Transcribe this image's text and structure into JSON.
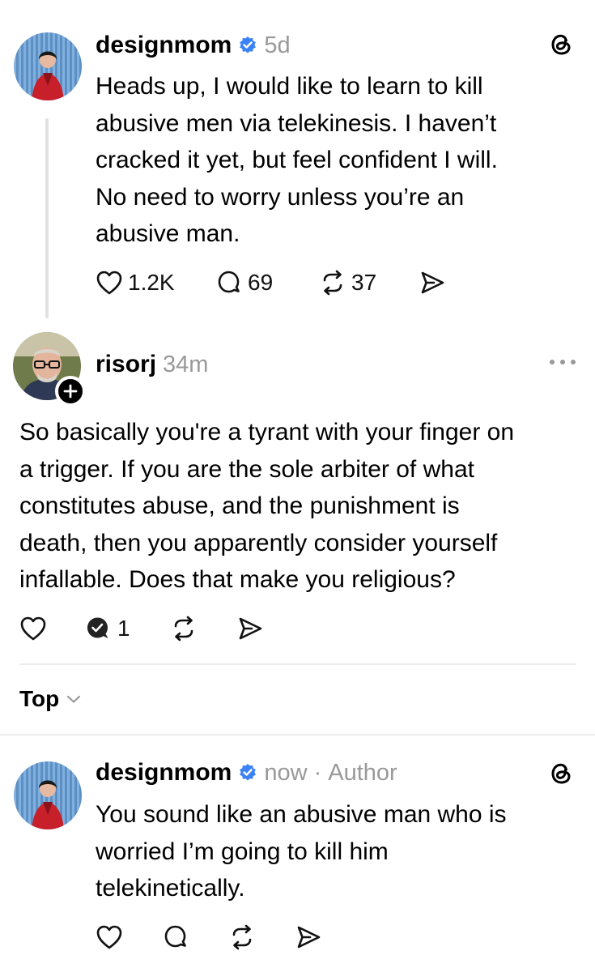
{
  "post": {
    "username": "designmom",
    "time": "5d",
    "lines": [
      "Heads up, I would like to learn to kill",
      "abusive men via telekinesis. I haven’t",
      "cracked it yet, but feel confident I will.",
      "No need to worry unless you’re an",
      "abusive man."
    ],
    "likes": "1.2K",
    "replies": "69",
    "reposts": "37",
    "icons": {
      "verified": "verified-badge-icon",
      "app": "threads-logo-icon"
    }
  },
  "reply": {
    "username": "risorj",
    "time": "34m",
    "lines": [
      "So basically you're a tyrant with your finger on",
      "a trigger.  If you are the sole arbiter of what",
      "constitutes abuse, and the punishment is",
      "death, then you apparently consider yourself",
      "infallable. Does that make you religious?"
    ],
    "replies": "1"
  },
  "sort": {
    "label": "Top"
  },
  "author_reply": {
    "username": "designmom",
    "time": "now",
    "separator": "·",
    "badge": "Author",
    "lines": [
      "You sound like an abusive man who is",
      "worried I’m going to kill him",
      "telekinetically."
    ]
  },
  "colors": {
    "verified": "#3b82f6",
    "muted": "#999999",
    "divider": "#ececec"
  }
}
